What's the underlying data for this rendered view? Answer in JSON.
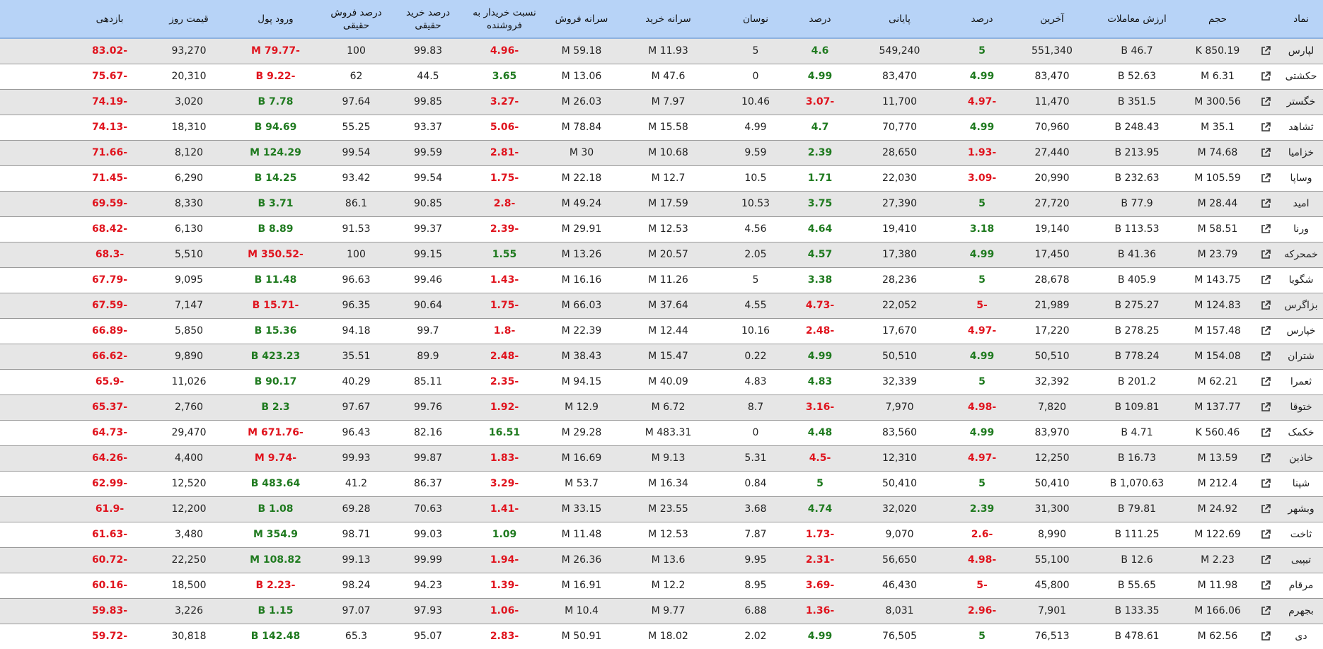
{
  "table": {
    "headers": [
      "نماد",
      "حجم",
      "ارزش معاملات",
      "آخرین",
      "درصد",
      "پایانی",
      "درصد",
      "نوسان",
      "سرانه خرید",
      "سرانه فروش",
      "نسبت خریدار به فروشنده",
      "درصد خرید حقیقی",
      "درصد فروش حقیقی",
      "ورود پول",
      "قیمت روز",
      "بازدهی"
    ],
    "rows": [
      [
        "لپارس",
        "850.19 K",
        "46.7 B",
        "551,340",
        "5",
        "549,240",
        "4.6",
        "5",
        "11.93 M",
        "59.18 M",
        "-4.96",
        "99.83",
        "100",
        "-79.77 M",
        "93,270",
        "-83.02"
      ],
      [
        "حکشتی",
        "6.31 M",
        "52.63 B",
        "83,470",
        "4.99",
        "83,470",
        "4.99",
        "0",
        "47.6 M",
        "13.06 M",
        "3.65",
        "44.5",
        "62",
        "-9.22 B",
        "20,310",
        "-75.67"
      ],
      [
        "خگستر",
        "300.56 M",
        "351.5 B",
        "11,470",
        "-4.97",
        "11,700",
        "-3.07",
        "10.46",
        "7.97 M",
        "26.03 M",
        "-3.27",
        "99.85",
        "97.64",
        "7.78 B",
        "3,020",
        "-74.19"
      ],
      [
        "ثشاهد",
        "35.1 M",
        "248.43 B",
        "70,960",
        "4.99",
        "70,770",
        "4.7",
        "4.99",
        "15.58 M",
        "78.84 M",
        "-5.06",
        "93.37",
        "55.25",
        "94.69 B",
        "18,310",
        "-74.13"
      ],
      [
        "خزامیا",
        "74.68 M",
        "213.95 B",
        "27,440",
        "-1.93",
        "28,650",
        "2.39",
        "9.59",
        "10.68 M",
        "30 M",
        "-2.81",
        "99.59",
        "99.54",
        "124.29 M",
        "8,120",
        "-71.66"
      ],
      [
        "وساپا",
        "105.59 M",
        "232.63 B",
        "20,990",
        "-3.09",
        "22,030",
        "1.71",
        "10.5",
        "12.7 M",
        "22.18 M",
        "-1.75",
        "99.54",
        "93.42",
        "14.25 B",
        "6,290",
        "-71.45"
      ],
      [
        "امید",
        "28.44 M",
        "77.9 B",
        "27,720",
        "5",
        "27,390",
        "3.75",
        "10.53",
        "17.59 M",
        "49.24 M",
        "-2.8",
        "90.85",
        "86.1",
        "3.71 B",
        "8,330",
        "-69.59"
      ],
      [
        "ورنا",
        "58.51 M",
        "113.53 B",
        "19,140",
        "3.18",
        "19,410",
        "4.64",
        "4.56",
        "12.53 M",
        "29.91 M",
        "-2.39",
        "99.37",
        "91.53",
        "8.89 B",
        "6,130",
        "-68.42"
      ],
      [
        "خمحرکه",
        "23.79 M",
        "41.36 B",
        "17,450",
        "4.99",
        "17,380",
        "4.57",
        "2.05",
        "20.57 M",
        "13.26 M",
        "1.55",
        "99.15",
        "100",
        "-350.52 M",
        "5,510",
        "-68.3"
      ],
      [
        "شگویا",
        "143.75 M",
        "405.9 B",
        "28,678",
        "5",
        "28,236",
        "3.38",
        "5",
        "11.26 M",
        "16.16 M",
        "-1.43",
        "99.46",
        "96.63",
        "11.48 B",
        "9,095",
        "-67.79"
      ],
      [
        "بزاگرس",
        "124.83 M",
        "275.27 B",
        "21,989",
        "-5",
        "22,052",
        "-4.73",
        "4.55",
        "37.64 M",
        "66.03 M",
        "-1.75",
        "90.64",
        "96.35",
        "-15.71 B",
        "7,147",
        "-67.59"
      ],
      [
        "خپارس",
        "157.48 M",
        "278.25 B",
        "17,220",
        "-4.97",
        "17,670",
        "-2.48",
        "10.16",
        "12.44 M",
        "22.39 M",
        "-1.8",
        "99.7",
        "94.18",
        "15.36 B",
        "5,850",
        "-66.89"
      ],
      [
        "شتران",
        "154.08 M",
        "778.24 B",
        "50,510",
        "4.99",
        "50,510",
        "4.99",
        "0.22",
        "15.47 M",
        "38.43 M",
        "-2.48",
        "89.9",
        "35.51",
        "423.23 B",
        "9,890",
        "-66.62"
      ],
      [
        "ثعمرا",
        "62.21 M",
        "201.2 B",
        "32,392",
        "5",
        "32,339",
        "4.83",
        "4.83",
        "40.09 M",
        "94.15 M",
        "-2.35",
        "85.11",
        "40.29",
        "90.17 B",
        "11,026",
        "-65.9"
      ],
      [
        "ختوقا",
        "137.77 M",
        "109.81 B",
        "7,820",
        "-4.98",
        "7,970",
        "-3.16",
        "8.7",
        "6.72 M",
        "12.9 M",
        "-1.92",
        "99.76",
        "97.67",
        "2.3 B",
        "2,760",
        "-65.37"
      ],
      [
        "خکمک",
        "560.46 K",
        "4.71 B",
        "83,970",
        "4.99",
        "83,560",
        "4.48",
        "0",
        "483.31 M",
        "29.28 M",
        "16.51",
        "82.16",
        "96.43",
        "-671.76 M",
        "29,470",
        "-64.73"
      ],
      [
        "خاذین",
        "13.59 M",
        "16.73 B",
        "12,250",
        "-4.97",
        "12,310",
        "-4.5",
        "5.31",
        "9.13 M",
        "16.69 M",
        "-1.83",
        "99.87",
        "99.93",
        "-9.74 M",
        "4,400",
        "-64.26"
      ],
      [
        "شپنا",
        "212.4 M",
        "1,070.63 B",
        "50,410",
        "5",
        "50,410",
        "5",
        "0.84",
        "16.34 M",
        "53.7 M",
        "-3.29",
        "86.37",
        "41.2",
        "483.64 B",
        "12,520",
        "-62.99"
      ],
      [
        "وبشهر",
        "24.92 M",
        "79.81 B",
        "31,300",
        "2.39",
        "32,020",
        "4.74",
        "3.68",
        "23.55 M",
        "33.15 M",
        "-1.41",
        "70.63",
        "69.28",
        "1.08 B",
        "12,200",
        "-61.9"
      ],
      [
        "ثاخت",
        "122.69 M",
        "111.25 B",
        "8,990",
        "-2.6",
        "9,070",
        "-1.73",
        "7.87",
        "12.53 M",
        "11.48 M",
        "1.09",
        "99.03",
        "98.71",
        "354.9 M",
        "3,480",
        "-61.63"
      ],
      [
        "تیپیی",
        "2.23 M",
        "12.6 B",
        "55,100",
        "-4.98",
        "56,650",
        "-2.31",
        "9.95",
        "13.6 M",
        "26.36 M",
        "-1.94",
        "99.99",
        "99.13",
        "108.82 M",
        "22,250",
        "-60.72"
      ],
      [
        "مرقام",
        "11.98 M",
        "55.65 B",
        "45,800",
        "-5",
        "46,430",
        "-3.69",
        "8.95",
        "12.2 M",
        "16.91 M",
        "-1.39",
        "94.23",
        "98.24",
        "-2.23 B",
        "18,500",
        "-60.16"
      ],
      [
        "بجهرم",
        "166.06 M",
        "133.35 B",
        "7,901",
        "-2.96",
        "8,031",
        "-1.36",
        "6.88",
        "9.77 M",
        "10.4 M",
        "-1.06",
        "97.93",
        "97.07",
        "1.15 B",
        "3,226",
        "-59.83"
      ],
      [
        "دی",
        "62.56 M",
        "478.61 B",
        "76,513",
        "5",
        "76,505",
        "4.99",
        "2.02",
        "18.02 M",
        "50.91 M",
        "-2.83",
        "95.07",
        "65.3",
        "142.48 B",
        "30,818",
        "-59.72"
      ]
    ]
  },
  "colors": {
    "header_bg": "#b7d3f7",
    "positive": "#1f7a1f",
    "negative": "#e0141e",
    "row_alt": "#e6e6e6"
  },
  "icons": {
    "row_link": "external-link-icon"
  }
}
